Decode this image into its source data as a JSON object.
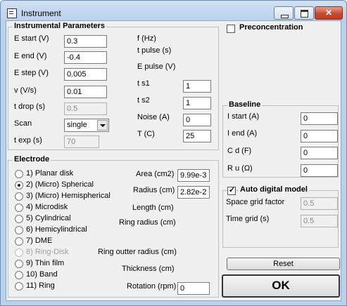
{
  "window": {
    "title": "Instrument",
    "close_glyph": "✕"
  },
  "instrumental": {
    "legend": "Instrumental Parameters",
    "left": [
      {
        "label": "E start (V)",
        "value": "0.3"
      },
      {
        "label": "E end  (V)",
        "value": "-0.4"
      },
      {
        "label": "E step (V)",
        "value": "0.005"
      },
      {
        "label": "v (V/s)",
        "value": "0.01"
      },
      {
        "label": "t drop  (s)",
        "value": "0.5"
      }
    ],
    "scan_label": "Scan",
    "scan_value": "single",
    "texp_label": "t exp (s)",
    "texp_value": "70",
    "right_labels": {
      "f": "f (Hz)",
      "tpulse": "t pulse (s)",
      "epulse": "E pulse (V)"
    },
    "right": [
      {
        "label": "t s1",
        "value": "1"
      },
      {
        "label": "t s2",
        "value": "1"
      },
      {
        "label": "Noise (A)",
        "value": "0"
      },
      {
        "label": "T (C)",
        "value": "25"
      }
    ]
  },
  "preconcentration": {
    "label": "Preconcentration",
    "checked": false
  },
  "baseline": {
    "legend": "Baseline",
    "fields": [
      {
        "label": "I start (A)",
        "value": "0"
      },
      {
        "label": "I end (A)",
        "value": "0"
      },
      {
        "label": "C d (F)",
        "value": "0"
      },
      {
        "label": "R u  (Ω)",
        "value": "0"
      }
    ]
  },
  "auto_model": {
    "label": "Auto digital model",
    "check": "✓",
    "checked": true,
    "fields": [
      {
        "label": "Space grid factor",
        "value": "0.5"
      },
      {
        "label": "Time grid (s)",
        "value": "0.5"
      }
    ]
  },
  "electrode": {
    "legend": "Electrode",
    "options": [
      {
        "label": "1)  Planar disk",
        "selected": false,
        "disabled": false
      },
      {
        "label": "2)  (Micro) Spherical",
        "selected": true,
        "disabled": false
      },
      {
        "label": "3)  (Micro) Hemispherical",
        "selected": false,
        "disabled": false
      },
      {
        "label": "4)  Microdisk",
        "selected": false,
        "disabled": false
      },
      {
        "label": "5)  Cylindrical",
        "selected": false,
        "disabled": false
      },
      {
        "label": "6)  Hemicylindrical",
        "selected": false,
        "disabled": false
      },
      {
        "label": "7)  DME",
        "selected": false,
        "disabled": false
      },
      {
        "label": "8)  Ring-Disk",
        "selected": false,
        "disabled": true
      },
      {
        "label": "9)  Thin film",
        "selected": false,
        "disabled": false
      },
      {
        "label": "10) Band",
        "selected": false,
        "disabled": false
      },
      {
        "label": "11) Ring",
        "selected": false,
        "disabled": false
      }
    ],
    "area_label": "Area (cm2)",
    "area_value": "9.99e-3",
    "radius_label": "Radius (cm)",
    "radius_value": "2.82e-2",
    "length_label": "Length (cm)",
    "ring_radius_label": "Ring radius (cm)",
    "ring_outter_label": "Ring outter radius (cm)",
    "thickness_label": "Thickness (cm)",
    "rotation_label": "Rotation (rpm)",
    "rotation_value": "0"
  },
  "buttons": {
    "reset": "Reset",
    "ok": "OK"
  }
}
